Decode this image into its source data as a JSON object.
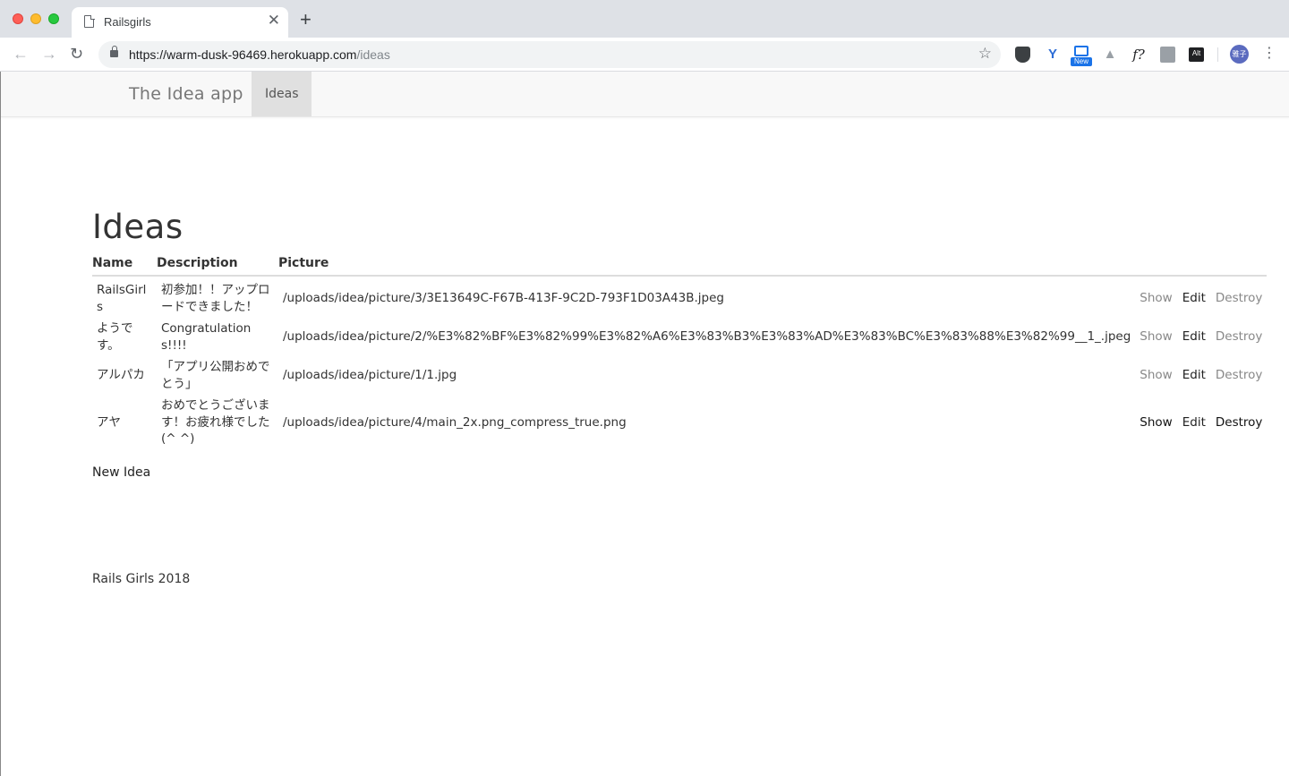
{
  "browser": {
    "tab_title": "Railsgirls",
    "url_host": "https://warm-dusk-96469.herokuapp.com",
    "url_path": "/ideas",
    "extensions": {
      "new_badge": "New",
      "f_label": "f?",
      "alt_label": "Alt"
    },
    "profile_initials": "雅子"
  },
  "navbar": {
    "brand": "The Idea app",
    "active_link": "Ideas"
  },
  "page": {
    "title": "Ideas",
    "columns": [
      "Name",
      "Description",
      "Picture"
    ],
    "rows": [
      {
        "name": "RailsGirls",
        "description": "初参加！！アップロードできました！",
        "picture": "/uploads/idea/picture/3/3E13649C-F67B-413F-9C2D-793F1D03A43B.jpeg",
        "show": "Show",
        "edit": "Edit",
        "destroy": "Destroy"
      },
      {
        "name": "ようです。",
        "description": "Congratulations!!!!",
        "picture": "/uploads/idea/picture/2/%E3%82%BF%E3%82%99%E3%82%A6%E3%83%B3%E3%83%AD%E3%83%BC%E3%83%88%E3%82%99__1_.jpeg",
        "show": "Show",
        "edit": "Edit",
        "destroy": "Destroy"
      },
      {
        "name": "アルパカ",
        "description": "「アプリ公開おめでとう」",
        "picture": "/uploads/idea/picture/1/1.jpg",
        "show": "Show",
        "edit": "Edit",
        "destroy": "Destroy"
      },
      {
        "name": "アヤ",
        "description": "おめでとうございます！お疲れ様でした(^ ^)",
        "picture": "/uploads/idea/picture/4/main_2x.png_compress_true.png",
        "show": "Show",
        "edit": "Edit",
        "destroy": "Destroy"
      }
    ],
    "new_link": "New Idea",
    "footer": "Rails Girls 2018"
  }
}
